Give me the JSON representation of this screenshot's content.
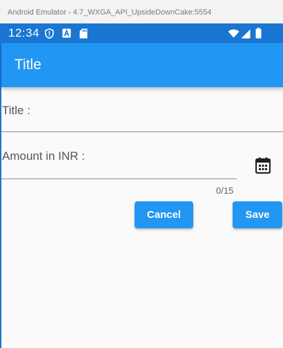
{
  "window": {
    "title": "Android Emulator - 4.7_WXGA_API_UpsideDownCake:5554"
  },
  "status_bar": {
    "time": "12:34",
    "icons": [
      "shield-icon",
      "text-a-icon",
      "sd-card-icon",
      "wifi-icon",
      "cell-signal-icon",
      "battery-icon"
    ]
  },
  "app_bar": {
    "title": "Title"
  },
  "form": {
    "title_label": "Title  :",
    "amount_label": "Amount in INR :",
    "amount_counter": "0/15",
    "calendar_icon": "calendar-icon"
  },
  "buttons": {
    "cancel": "Cancel",
    "save": "Save"
  },
  "colors": {
    "status_bar": "#1976d2",
    "app_bar": "#2196f3",
    "button": "#2196f3",
    "background": "#fafafa"
  }
}
